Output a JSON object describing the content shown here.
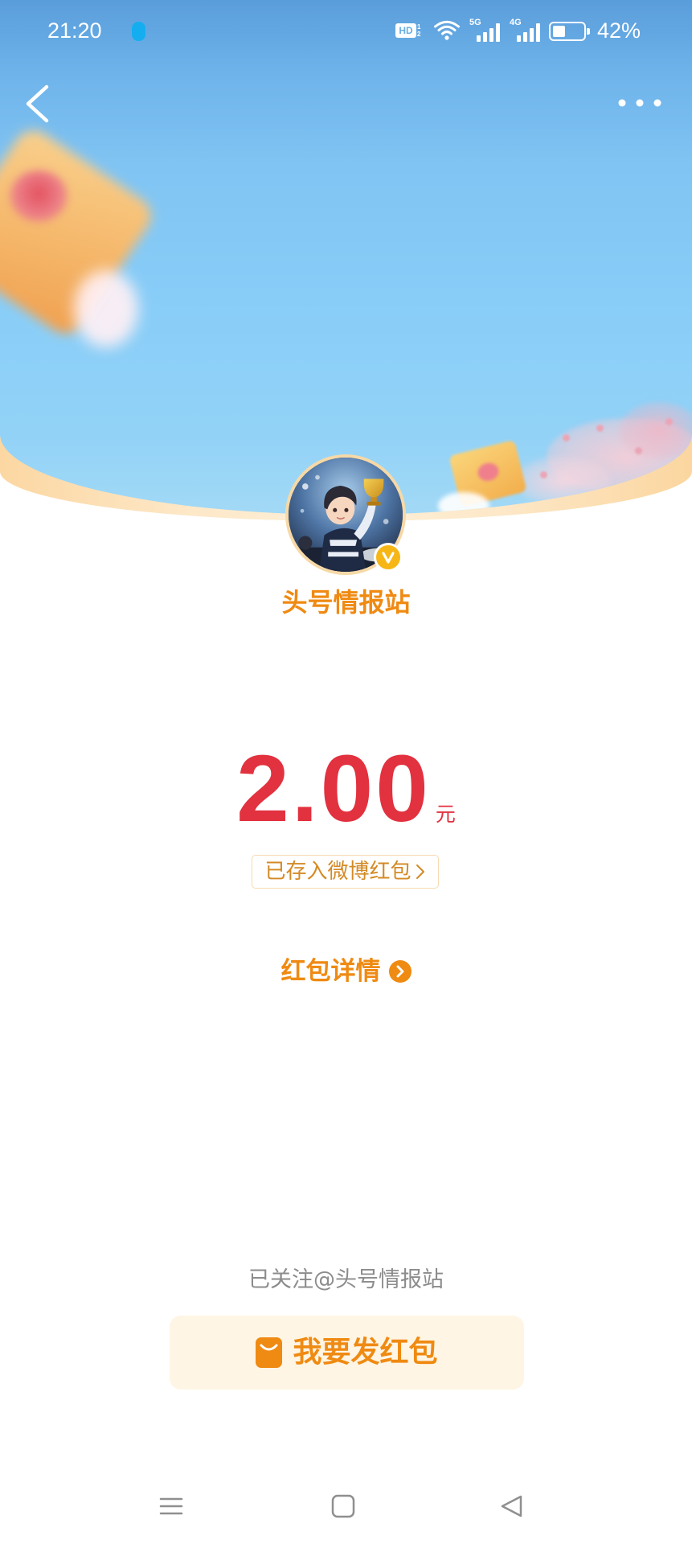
{
  "status_bar": {
    "time": "21:20",
    "notification_icon": "app-notification-icon",
    "hd_label": "HD",
    "hd_sub_top": "1",
    "hd_sub_bottom": "2",
    "wifi_icon": "wifi-icon",
    "network_1": "5G",
    "network_2": "4G",
    "battery_icon": "battery-icon",
    "battery_level": 0.42,
    "battery": "42%"
  },
  "top_nav": {
    "back_icon": "back-arrow-icon",
    "more_icon": "more-icon"
  },
  "sender": {
    "name": "头号情报站",
    "avatar_icon": "avatar",
    "verified_icon": "verified-badge-icon"
  },
  "amount": {
    "value": "2.00",
    "unit": "元"
  },
  "deposit_link": {
    "label": "已存入微博红包",
    "icon": "chevron-right-icon"
  },
  "details_link": {
    "label": "红包详情",
    "icon": "chevron-circle-icon"
  },
  "follow_status": "已关注@头号情报站",
  "send_button": {
    "label": "我要发红包",
    "icon": "red-packet-icon"
  },
  "system_nav": {
    "icons": [
      "menu-icon",
      "home-icon",
      "back-icon"
    ]
  },
  "theme": {
    "accent": "#ef8a12",
    "amount": "#e2313f",
    "deposit": "#d38a25",
    "button_bg": "#fff5e4",
    "muted": "#8c8c8c",
    "header_blue": "#88cdf8"
  }
}
